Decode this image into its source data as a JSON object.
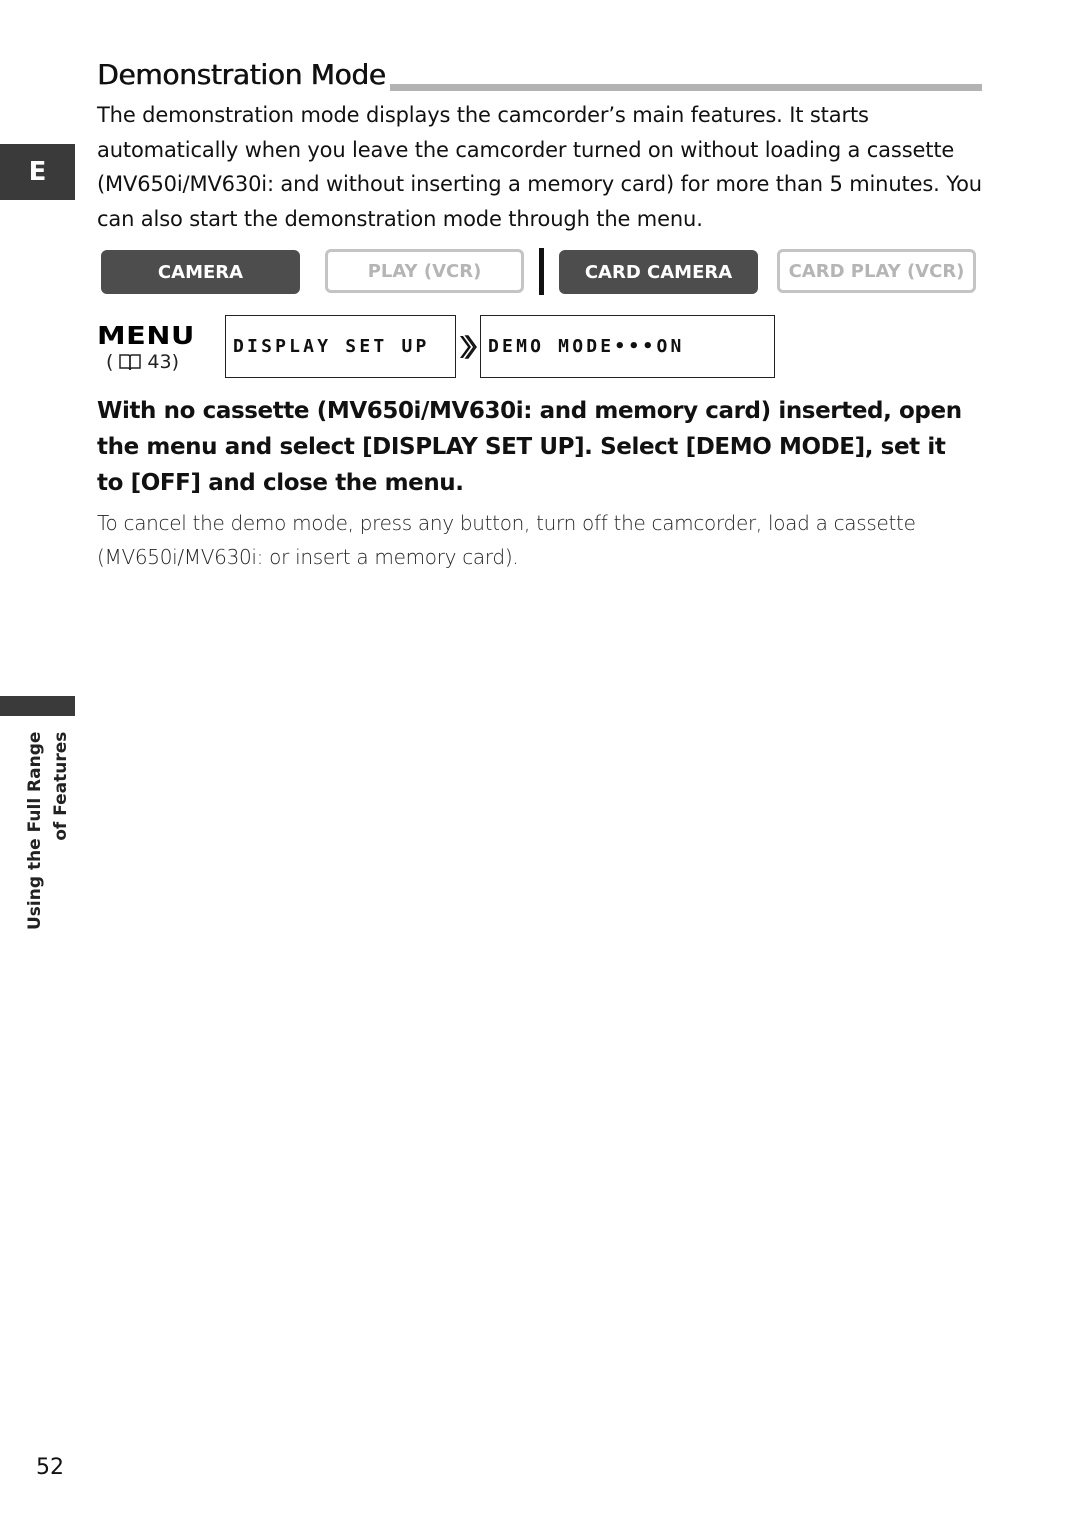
{
  "page": {
    "title": "Demonstration Mode",
    "language_tab": "E",
    "intro_text": "The demonstration mode displays the camcorder’s main features. It starts automatically when you leave the camcorder turned on without loading a cassette (MV650i/MV630i: and without inserting a memory card) for more than 5 minutes. You can also start the demonstration mode through the menu.",
    "modes": [
      {
        "label": "CAMERA",
        "state": "active"
      },
      {
        "label": "PLAY (VCR)",
        "state": "inactive"
      },
      {
        "label": "CARD CAMERA",
        "state": "active"
      },
      {
        "label": "CARD PLAY (VCR)",
        "state": "inactive"
      }
    ],
    "menu": {
      "logo": "MENU",
      "ref_open": "(",
      "ref_page": "43)",
      "ref_icon": "book-icon",
      "path": [
        "DISPLAY SET UP",
        "DEMO MODE•••ON"
      ],
      "separator_icon": "double-chevron-right-icon"
    },
    "instruction": "With no cassette (MV650i/MV630i: and memory card) inserted, open the menu and select [DISPLAY SET UP]. Select [DEMO MODE], set it to [OFF] and close the menu.",
    "note": "To cancel the demo mode, press any button, turn off the camcorder, load a cassette (MV650i/MV630i: or insert a memory card).",
    "section_label": [
      "Using the Full Range",
      "of Features"
    ],
    "page_number": "52"
  },
  "colors": {
    "active_mode_bg": "#4d4d4d",
    "inactive_mode_border": "#c4c4c4",
    "inactive_mode_text": "#b5b5b5",
    "tab_bg": "#3a3a3a",
    "title_rule": "#b3b3b3"
  }
}
